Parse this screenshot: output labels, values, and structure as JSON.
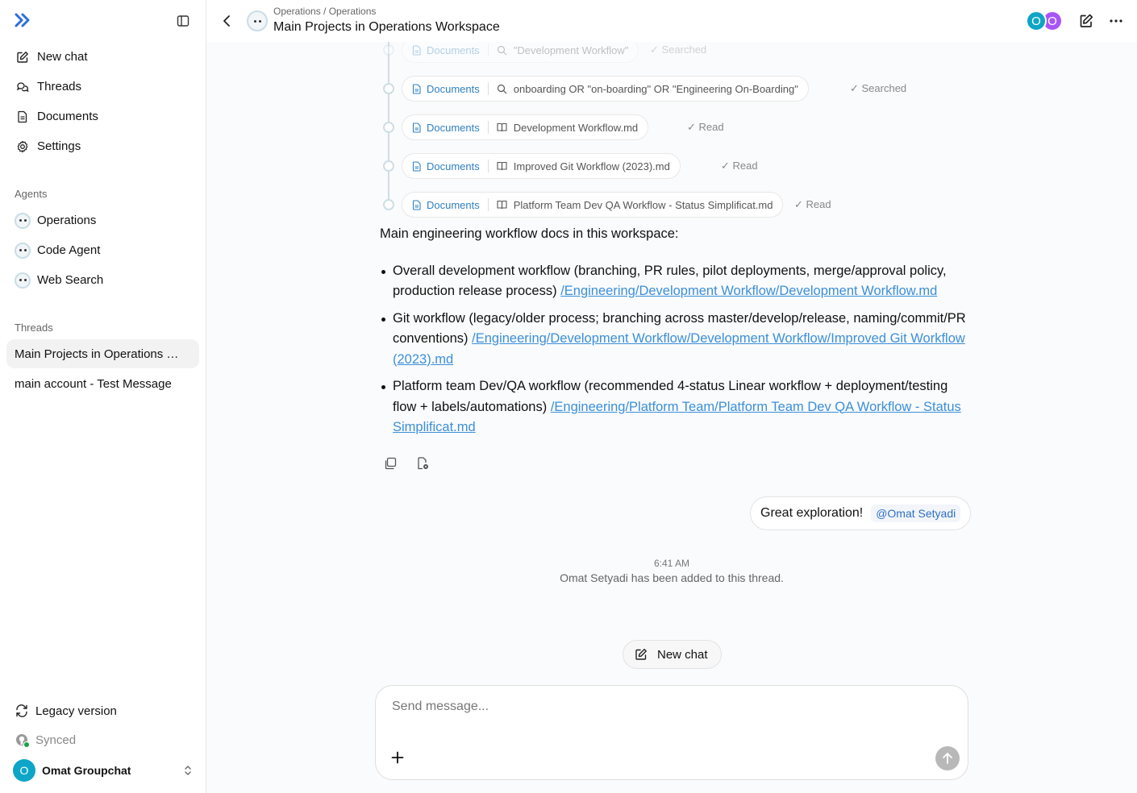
{
  "sidebar": {
    "logo_icon": "double-chevron-right-icon",
    "nav": [
      {
        "label": "New chat",
        "icon": "edit-icon"
      },
      {
        "label": "Threads",
        "icon": "chat-bubbles-icon"
      },
      {
        "label": "Documents",
        "icon": "document-icon"
      },
      {
        "label": "Settings",
        "icon": "gear-icon"
      }
    ],
    "agents_label": "Agents",
    "agents": [
      {
        "label": "Operations"
      },
      {
        "label": "Code Agent"
      },
      {
        "label": "Web Search"
      }
    ],
    "threads_label": "Threads",
    "threads": [
      {
        "label": "Main Projects in Operations Workspace",
        "active": true
      },
      {
        "label": "main account - Test Message",
        "active": false
      }
    ],
    "legacy_label": "Legacy version",
    "synced_label": "Synced",
    "user": {
      "initial": "O",
      "name": "Omat Groupchat"
    }
  },
  "header": {
    "breadcrumb": "Operations / Operations",
    "title": "Main Projects in Operations Workspace",
    "avatars": [
      {
        "initial": "O",
        "color": "#0ea5c6"
      },
      {
        "initial": "O",
        "color": "#a855f7"
      }
    ]
  },
  "tool_calls": [
    {
      "source": "Documents",
      "query": "\"Development Workflow\"",
      "query_icon": "search-icon",
      "status": "✓ Searched"
    },
    {
      "source": "Documents",
      "query": "onboarding OR \"on-boarding\" OR \"Engineering On-Boarding\"",
      "query_icon": "search-icon",
      "status": "✓ Searched"
    },
    {
      "source": "Documents",
      "query": "Development Workflow.md",
      "query_icon": "book-icon",
      "status": "✓ Read"
    },
    {
      "source": "Documents",
      "query": "Improved Git Workflow (2023).md",
      "query_icon": "book-icon",
      "status": "✓ Read"
    },
    {
      "source": "Documents",
      "query": "Platform Team Dev QA Workflow - Status Simplificat.md",
      "query_icon": "book-icon",
      "status": "✓ Read"
    }
  ],
  "message": {
    "intro": "Main engineering workflow docs in this workspace:",
    "items": [
      {
        "text": "Overall development workflow (branching, PR rules, pilot deployments, merge/approval policy, production release process) ",
        "link": "/Engineering/Development Workflow/Development Workflow.md"
      },
      {
        "text": "Git workflow (legacy/older process; branching across master/develop/release, naming/commit/PR conventions) ",
        "link": "/Engineering/Development Workflow/Development Workflow/Improved Git Workflow (2023).md"
      },
      {
        "text": "Platform team Dev/QA workflow (recommended 4-status Linear workflow + deployment/testing flow + labels/automations) ",
        "link": "/Engineering/Platform Team/Platform Team Dev QA Workflow - Status Simplificat.md"
      }
    ]
  },
  "user_message": {
    "text": "Great exploration!",
    "mention": "@Omat Setyadi"
  },
  "system": {
    "time": "6:41 AM",
    "note": "Omat Setyadi has been added to this thread."
  },
  "new_chat_button": "New chat",
  "composer": {
    "placeholder": "Send message..."
  }
}
